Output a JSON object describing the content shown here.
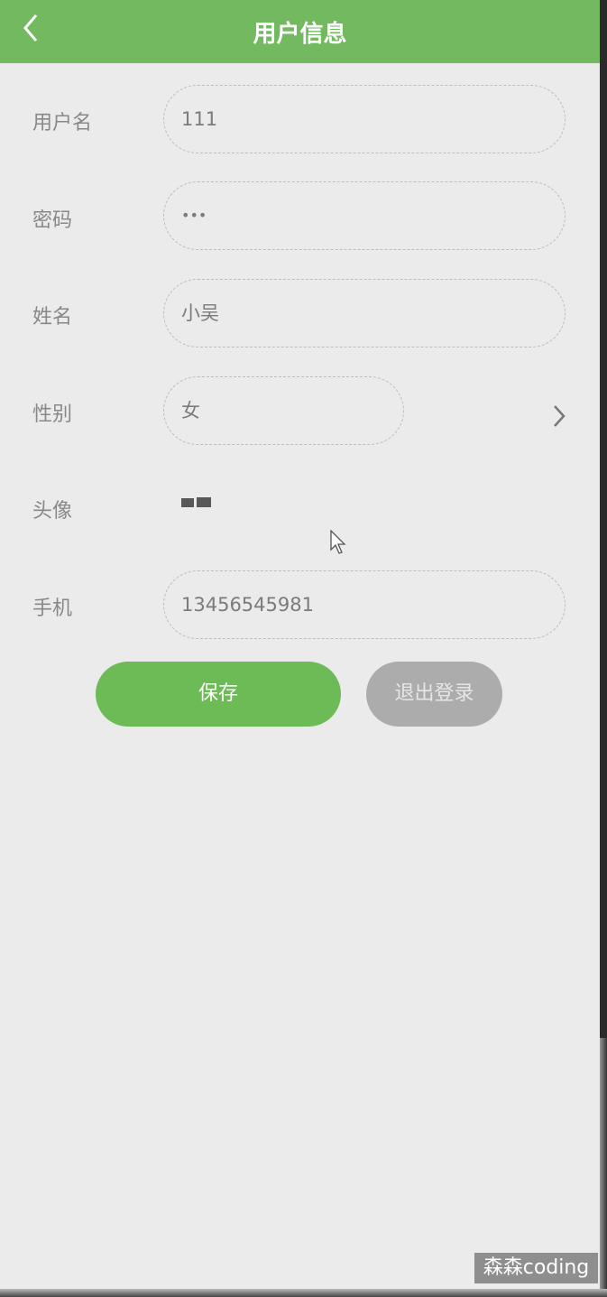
{
  "header": {
    "title": "用户信息",
    "back_icon": "chevron-left-icon",
    "color": "#72b95f"
  },
  "form": {
    "fields": [
      {
        "label": "用户名",
        "value": "111"
      },
      {
        "label": "密码",
        "value": "•••"
      },
      {
        "label": "姓名",
        "value": "小吴"
      },
      {
        "label": "性别",
        "value": "女"
      },
      {
        "label": "头像"
      },
      {
        "label": "手机",
        "value": "13456545981"
      }
    ]
  },
  "buttons": {
    "save": "保存",
    "logout": "退出登录",
    "save_color": "#6cbb57",
    "logout_color": "#acacac"
  },
  "watermark": "森森coding"
}
